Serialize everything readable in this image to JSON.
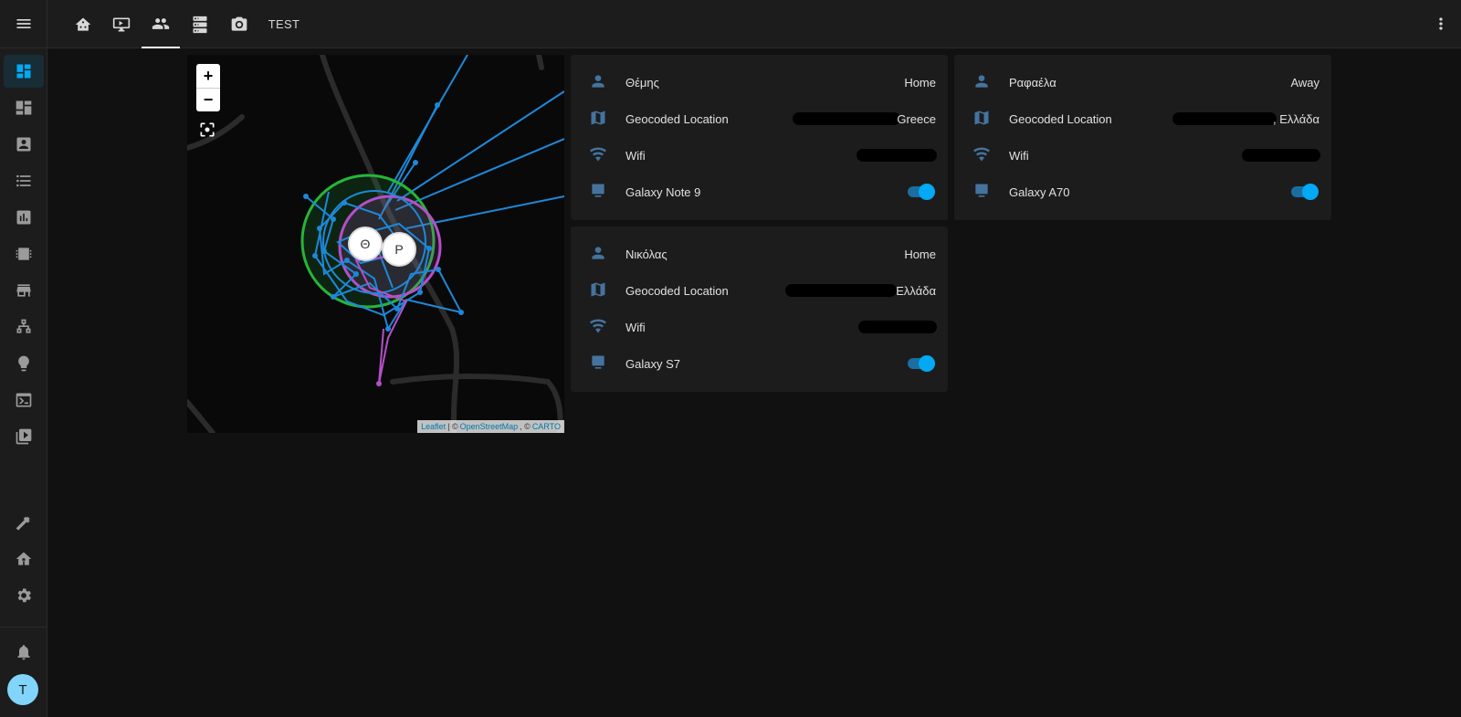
{
  "header": {
    "tabs": [
      {
        "icon": "home-assistant-icon",
        "active": false
      },
      {
        "icon": "monitor-dashboard-icon",
        "active": false
      },
      {
        "icon": "account-group-icon",
        "active": true
      },
      {
        "icon": "server-icon",
        "active": false
      },
      {
        "icon": "camera-icon",
        "active": false
      }
    ],
    "text_tab": "TEST"
  },
  "sidebar": {
    "items": [
      "view-dashboard-icon",
      "view-dashboard-variant-icon",
      "account-box-icon",
      "format-list-bulleted-icon",
      "chart-box-icon",
      "memory-icon",
      "store-icon",
      "sitemap-icon",
      "lightbulb-icon",
      "console-icon",
      "play-box-multiple-icon"
    ],
    "bottom_items": [
      "hammer-icon",
      "home-gear-icon",
      "cog-icon",
      "bell-icon"
    ],
    "avatar_initial": "T"
  },
  "map": {
    "markers": [
      {
        "label": "Θ"
      },
      {
        "label": "P"
      }
    ],
    "attribution": {
      "leaflet": "Leaflet",
      "sep1": "| ©",
      "osm": "OpenStreetMap",
      "sep2": ", ©",
      "carto": "CARTO"
    },
    "zoom_in": "+",
    "zoom_out": "−"
  },
  "cards": [
    {
      "rows": [
        {
          "icon": "account-icon",
          "name": "Θέμης",
          "value": "Home"
        },
        {
          "icon": "map-icon",
          "name": "Geocoded Location",
          "value": "Greece"
        },
        {
          "icon": "wifi-icon",
          "name": "Wifi",
          "value": ""
        },
        {
          "icon": "cellphone-icon",
          "name": "Galaxy Note 9",
          "toggle": true
        }
      ]
    },
    {
      "rows": [
        {
          "icon": "account-icon",
          "name": "Νικόλας",
          "value": "Home"
        },
        {
          "icon": "map-icon",
          "name": "Geocoded Location",
          "value": "Ελλάδα"
        },
        {
          "icon": "wifi-icon",
          "name": "Wifi",
          "value": ""
        },
        {
          "icon": "cellphone-icon",
          "name": "Galaxy S7",
          "toggle": true
        }
      ]
    },
    {
      "rows": [
        {
          "icon": "account-icon",
          "name": "Ραφαέλα",
          "value": "Away"
        },
        {
          "icon": "map-icon",
          "name": "Geocoded Location",
          "value": ", Ελλάδα"
        },
        {
          "icon": "wifi-icon",
          "name": "Wifi",
          "value": ""
        },
        {
          "icon": "cellphone-icon",
          "name": "Galaxy A70",
          "toggle": true
        }
      ]
    }
  ],
  "colors": {
    "accent": "#03a9f4",
    "icon": "#44739e",
    "card": "#1c1c1c",
    "background": "#111111"
  }
}
